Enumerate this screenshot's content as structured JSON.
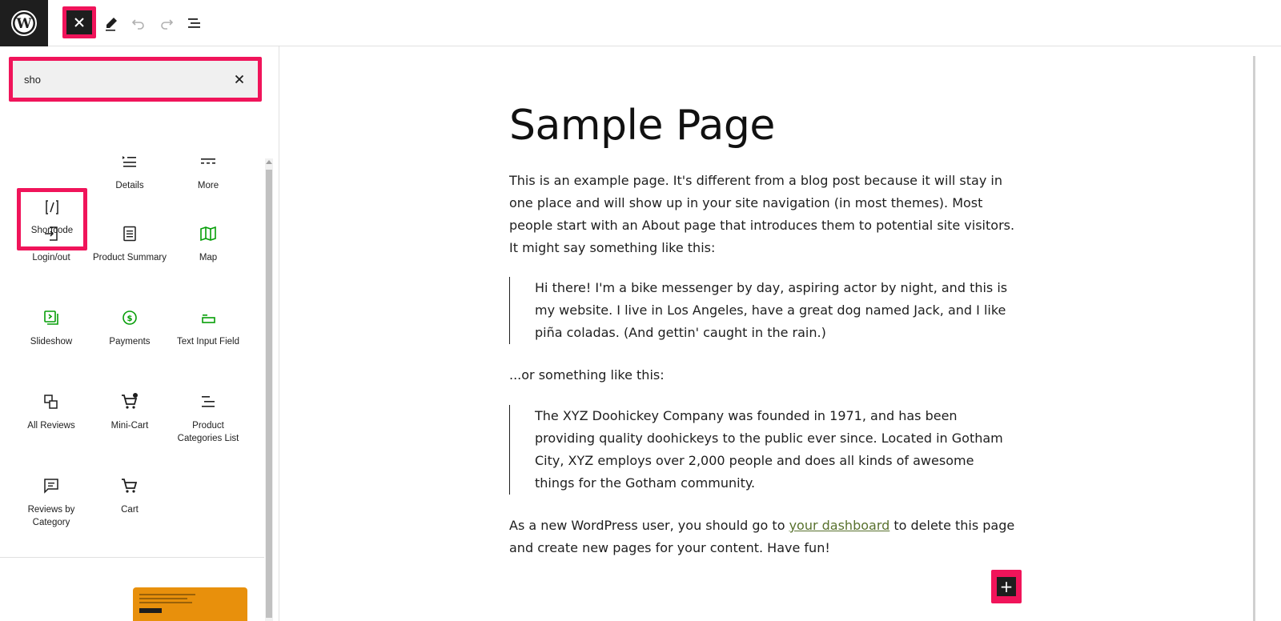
{
  "toolbar": {
    "logo_icon": "wordpress-logo",
    "close_icon": "close-icon",
    "tools": [
      "pencil-icon",
      "undo-icon",
      "redo-icon",
      "document-overview-icon"
    ]
  },
  "inserter": {
    "search": {
      "value": "sho",
      "clear_icon": "close-icon"
    },
    "blocks": [
      {
        "name": "Shortcode",
        "icon": "shortcode-icon",
        "color": "#1e1e1e"
      },
      {
        "name": "Details",
        "icon": "details-icon",
        "color": "#1e1e1e"
      },
      {
        "name": "More",
        "icon": "more-icon",
        "color": "#1e1e1e"
      },
      {
        "name": "Login/out",
        "icon": "login-icon",
        "color": "#1e1e1e"
      },
      {
        "name": "Product Summary",
        "icon": "product-summary-icon",
        "color": "#1e1e1e"
      },
      {
        "name": "Map",
        "icon": "map-icon",
        "color": "#069e08"
      },
      {
        "name": "Slideshow",
        "icon": "slideshow-icon",
        "color": "#069e08"
      },
      {
        "name": "Payments",
        "icon": "payments-icon",
        "color": "#069e08"
      },
      {
        "name": "Text Input Field",
        "icon": "text-input-icon",
        "color": "#069e08"
      },
      {
        "name": "All Reviews",
        "icon": "all-reviews-icon",
        "color": "#1e1e1e"
      },
      {
        "name": "Mini-Cart",
        "icon": "mini-cart-icon",
        "color": "#1e1e1e"
      },
      {
        "name": "Product Categories List",
        "icon": "categories-list-icon",
        "color": "#1e1e1e"
      },
      {
        "name": "Reviews by Category",
        "icon": "reviews-category-icon",
        "color": "#1e1e1e"
      },
      {
        "name": "Cart",
        "icon": "cart-icon",
        "color": "#1e1e1e"
      }
    ]
  },
  "page": {
    "title": "Sample Page",
    "intro": "This is an example page. It's different from a blog post because it will stay in one place and will show up in your site navigation (in most themes). Most people start with an About page that introduces them to potential site visitors. It might say something like this:",
    "quote1": "Hi there! I'm a bike messenger by day, aspiring actor by night, and this is my website. I live in Los Angeles, have a great dog named Jack, and I like piña coladas. (And gettin' caught in the rain.)",
    "middle": "...or something like this:",
    "quote2": "The XYZ Doohickey Company was founded in 1971, and has been providing quality doohickeys to the public ever since. Located in Gotham City, XYZ employs over 2,000 people and does all kinds of awesome things for the Gotham community.",
    "outro_before_link": "As a new WordPress user, you should go to ",
    "outro_link": "your dashboard",
    "outro_after_link": " to delete this page and create new pages for your content. Have fun!",
    "add_block_icon": "plus-icon"
  }
}
